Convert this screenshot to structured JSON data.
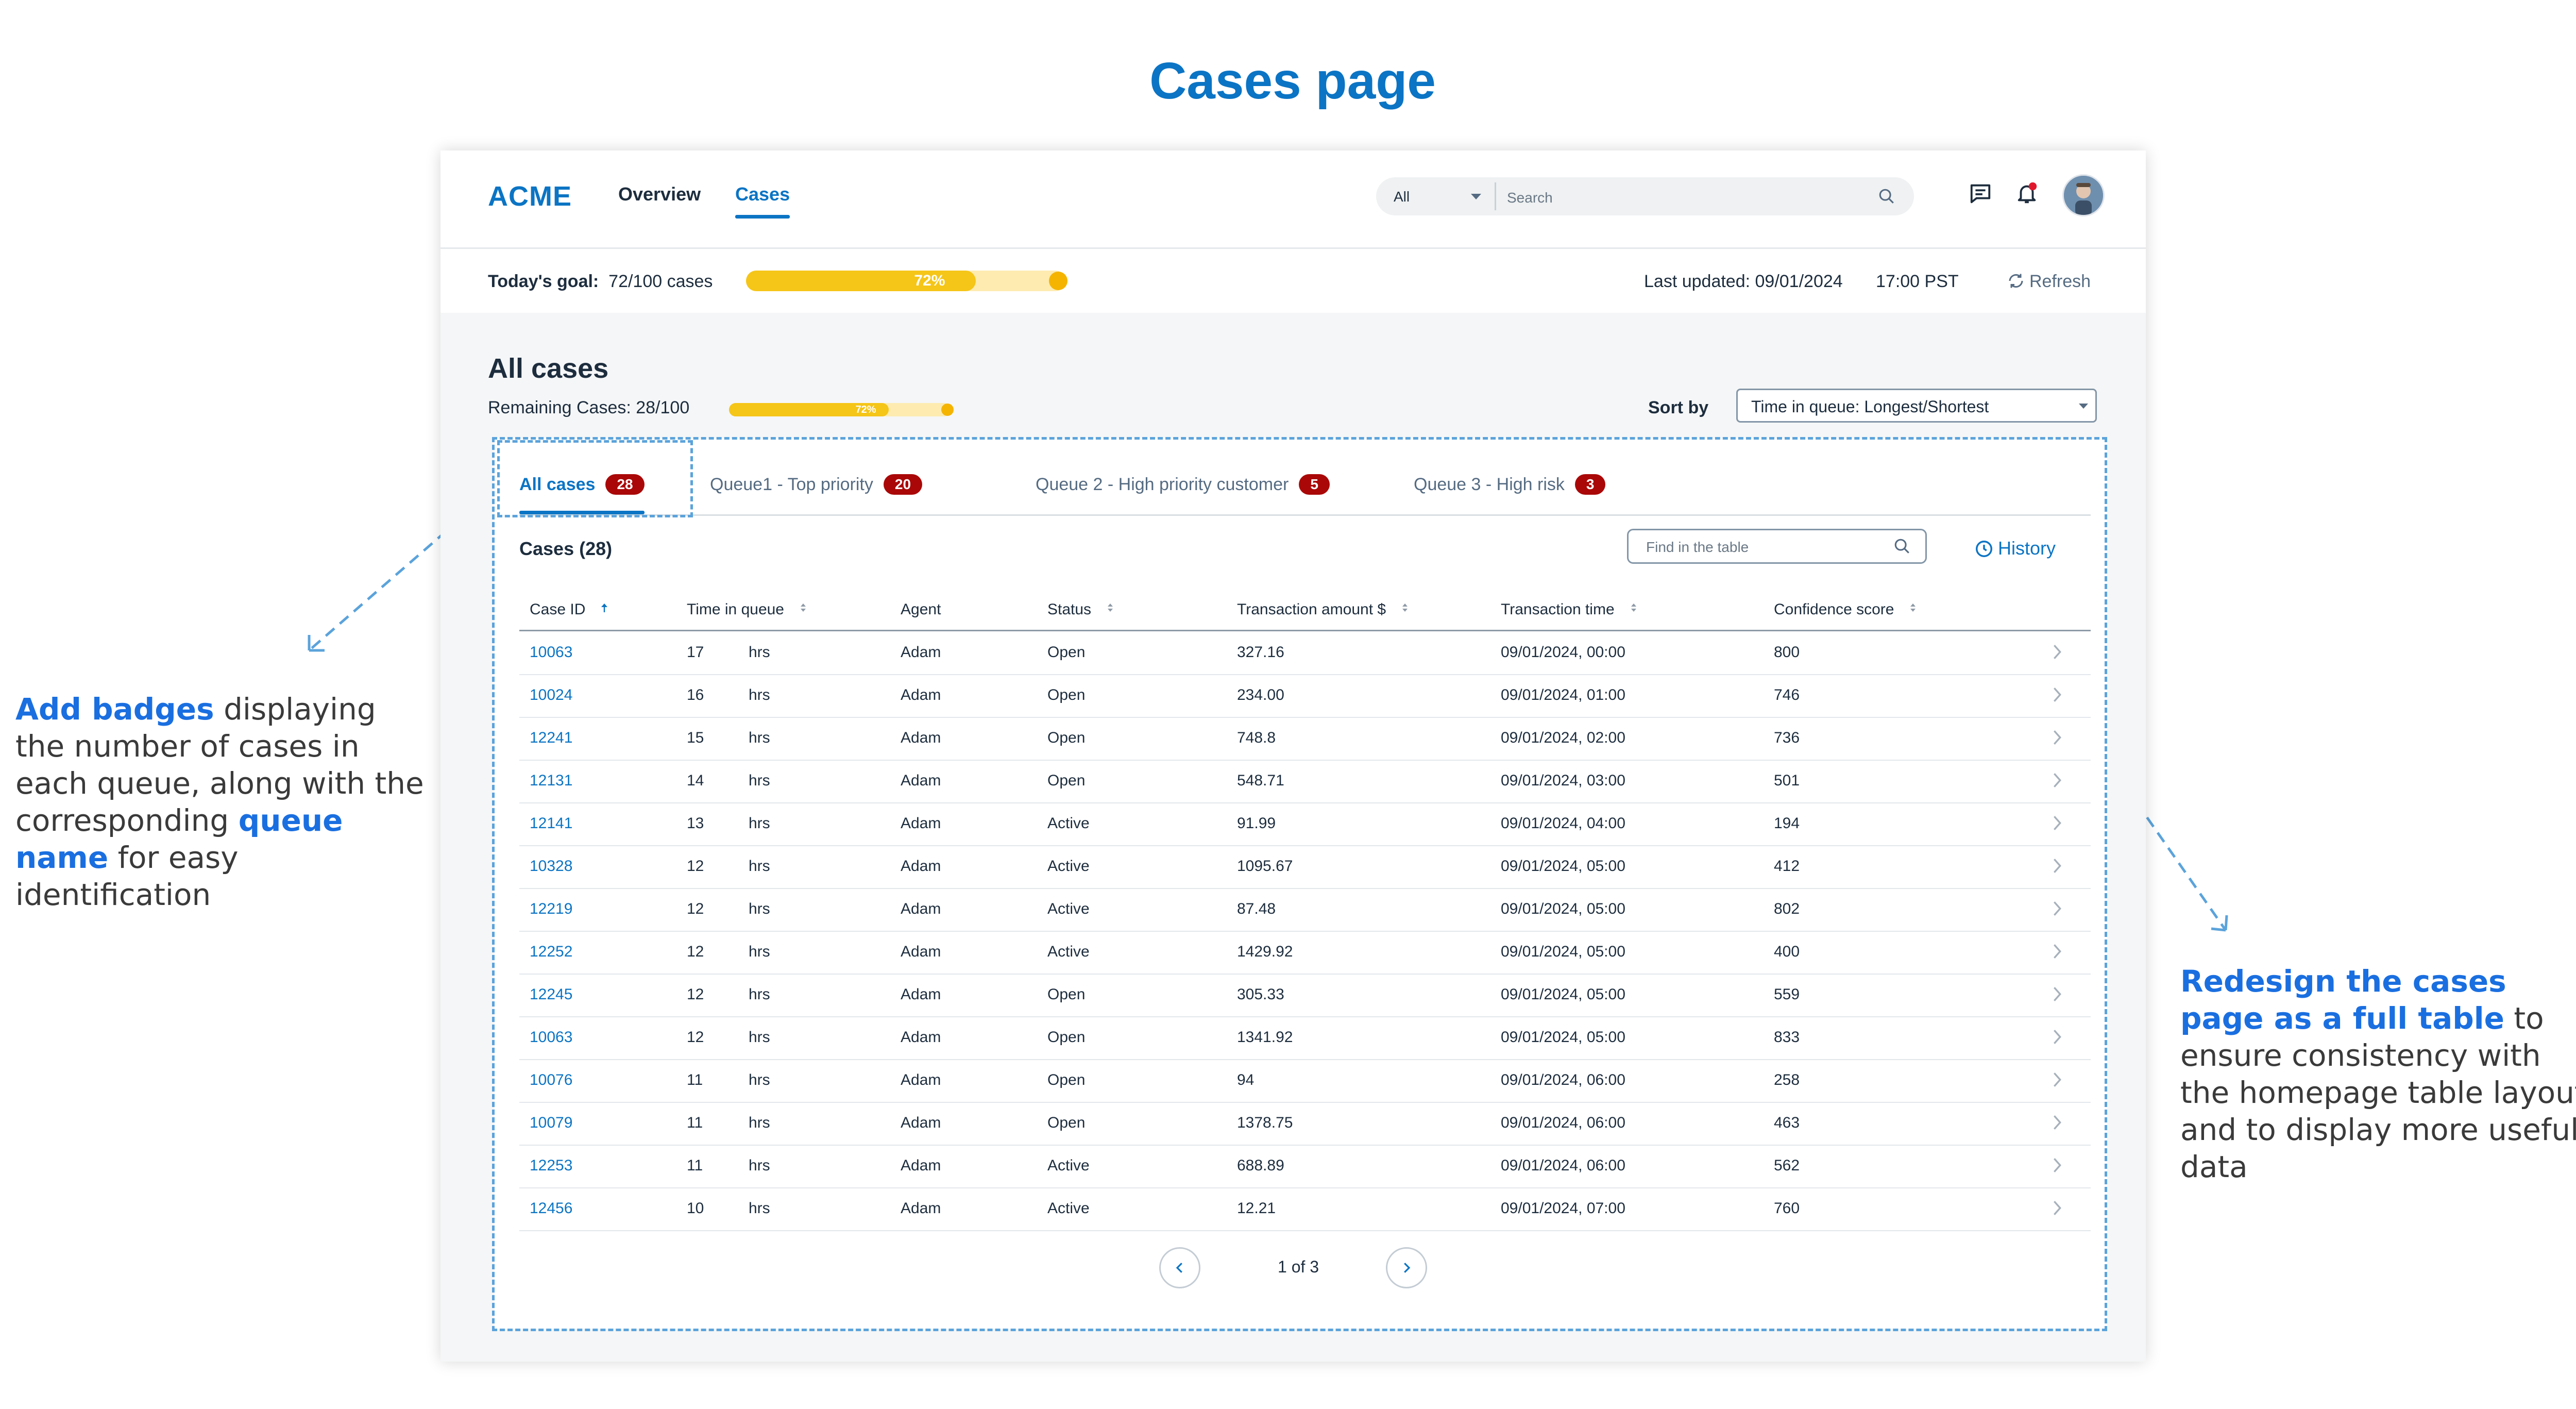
{
  "page_title": "Cases page",
  "annotations": {
    "left": {
      "bold1": "Add badges",
      "text1": " displaying the number of cases in each queue, along with the corresponding ",
      "bold2": "queue name",
      "text2": " for easy identification"
    },
    "right": {
      "bold1": "Redesign the cases page as a full table",
      "text1": " to ensure consistency with the homepage table layout and to display more useful data"
    }
  },
  "app": {
    "logo": "ACME",
    "nav": {
      "overview": "Overview",
      "cases": "Cases"
    },
    "search": {
      "scope": "All",
      "placeholder": "Search"
    },
    "icons": {
      "messages": "message-icon",
      "notifications": "bell-icon",
      "search": "search-icon"
    },
    "goal": {
      "label": "Today's goal:",
      "value": "72/100 cases",
      "percent_label": "72%",
      "progress": 0.72
    },
    "last_updated": {
      "label": "Last updated: 09/01/2024",
      "time": "17:00 PST"
    },
    "refresh": "Refresh",
    "heading": "All cases",
    "remaining": {
      "label": "Remaining Cases:  28/100",
      "percent_label": "72%",
      "progress": 0.72
    },
    "sort": {
      "label": "Sort by",
      "value": "Time in queue: Longest/Shortest"
    },
    "tabs": [
      {
        "label": "All cases",
        "count": "28"
      },
      {
        "label": "Queue1 - Top priority",
        "count": "20"
      },
      {
        "label": "Queue 2 - High priority customer",
        "count": "5"
      },
      {
        "label": "Queue 3 - High risk",
        "count": "3"
      }
    ],
    "cases_title": "Cases (28)",
    "find_placeholder": "Find in the table",
    "history": "History",
    "columns": [
      "Case ID",
      "Time in queue",
      "Agent",
      "Status",
      "Transaction amount $",
      "Transaction time",
      "Confidence score"
    ],
    "rows": [
      {
        "id": "10063",
        "time": "17",
        "unit": "hrs",
        "agent": "Adam",
        "status": "Open",
        "amount": "327.16",
        "ttime": "09/01/2024, 00:00",
        "score": "800"
      },
      {
        "id": "10024",
        "time": "16",
        "unit": "hrs",
        "agent": "Adam",
        "status": "Open",
        "amount": "234.00",
        "ttime": "09/01/2024, 01:00",
        "score": "746"
      },
      {
        "id": "12241",
        "time": "15",
        "unit": "hrs",
        "agent": "Adam",
        "status": "Open",
        "amount": "748.8",
        "ttime": "09/01/2024, 02:00",
        "score": "736"
      },
      {
        "id": "12131",
        "time": "14",
        "unit": "hrs",
        "agent": "Adam",
        "status": "Open",
        "amount": "548.71",
        "ttime": "09/01/2024, 03:00",
        "score": "501"
      },
      {
        "id": "12141",
        "time": "13",
        "unit": "hrs",
        "agent": "Adam",
        "status": "Active",
        "amount": "91.99",
        "ttime": "09/01/2024, 04:00",
        "score": "194"
      },
      {
        "id": "10328",
        "time": "12",
        "unit": "hrs",
        "agent": "Adam",
        "status": "Active",
        "amount": "1095.67",
        "ttime": "09/01/2024, 05:00",
        "score": "412"
      },
      {
        "id": "12219",
        "time": "12",
        "unit": "hrs",
        "agent": "Adam",
        "status": "Active",
        "amount": "87.48",
        "ttime": "09/01/2024, 05:00",
        "score": "802"
      },
      {
        "id": "12252",
        "time": "12",
        "unit": "hrs",
        "agent": "Adam",
        "status": "Active",
        "amount": "1429.92",
        "ttime": "09/01/2024, 05:00",
        "score": "400"
      },
      {
        "id": "12245",
        "time": "12",
        "unit": "hrs",
        "agent": "Adam",
        "status": "Open",
        "amount": "305.33",
        "ttime": "09/01/2024, 05:00",
        "score": "559"
      },
      {
        "id": "10063",
        "time": "12",
        "unit": "hrs",
        "agent": "Adam",
        "status": "Open",
        "amount": "1341.92",
        "ttime": "09/01/2024, 05:00",
        "score": "833"
      },
      {
        "id": "10076",
        "time": "11",
        "unit": "hrs",
        "agent": "Adam",
        "status": "Open",
        "amount": "94",
        "ttime": "09/01/2024, 06:00",
        "score": "258"
      },
      {
        "id": "10079",
        "time": "11",
        "unit": "hrs",
        "agent": "Adam",
        "status": "Open",
        "amount": "1378.75",
        "ttime": "09/01/2024, 06:00",
        "score": "463"
      },
      {
        "id": "12253",
        "time": "11",
        "unit": "hrs",
        "agent": "Adam",
        "status": "Active",
        "amount": "688.89",
        "ttime": "09/01/2024, 06:00",
        "score": "562"
      },
      {
        "id": "12456",
        "time": "10",
        "unit": "hrs",
        "agent": "Adam",
        "status": "Active",
        "amount": "12.21",
        "ttime": "09/01/2024, 07:00",
        "score": "760"
      }
    ],
    "pager": "1 of 3"
  },
  "colors": {
    "brand": "#0b74c4",
    "badge": "#aa0808",
    "progress": "#f5c518",
    "progress_track": "#fdebb0",
    "annotation_highlight": "#1a6fe0",
    "dashed_outline": "#5ba3db"
  }
}
